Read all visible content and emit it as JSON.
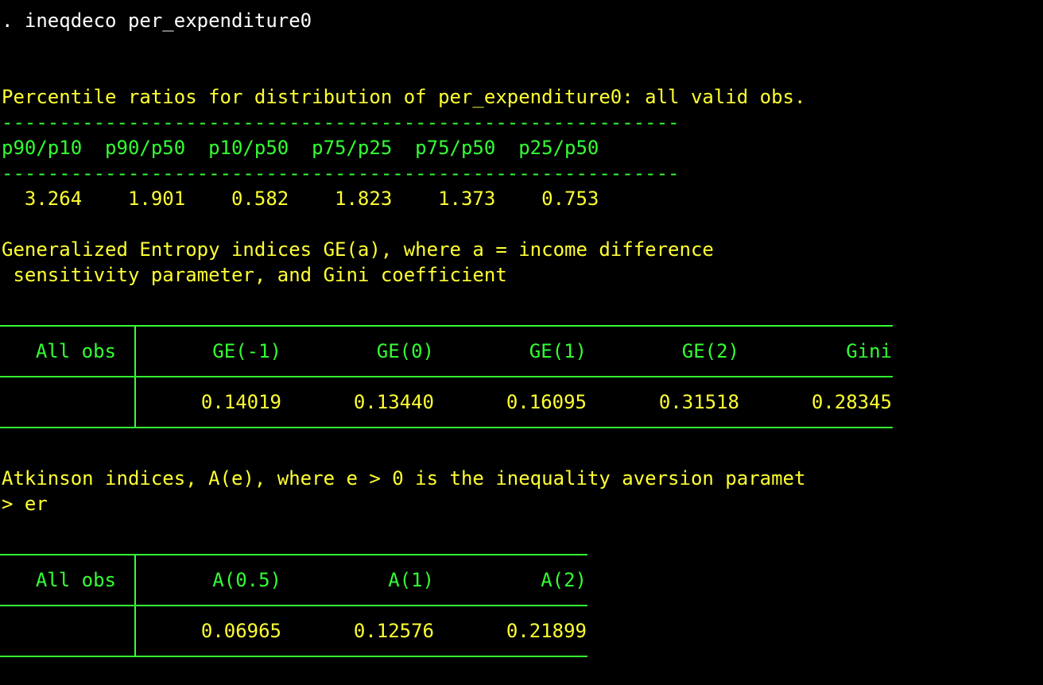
{
  "command": ". ineqdeco per_expenditure0",
  "percentile": {
    "title": "Percentile ratios for distribution of per_expenditure0: all valid obs.",
    "dashes": "-----------------------------------------------------------",
    "header": "p90/p10  p90/p50  p10/p50  p75/p25  p75/p50  p25/p50",
    "values": "  3.264    1.901    0.582    1.823    1.373    0.753"
  },
  "ge": {
    "title_line1": "Generalized Entropy indices GE(a), where a = income difference",
    "title_line2": " sensitivity parameter, and Gini coefficient",
    "row_label": "All obs",
    "headers": [
      "GE(-1)",
      "GE(0)",
      "GE(1)",
      "GE(2)",
      "Gini"
    ],
    "values": [
      "0.14019",
      "0.13440",
      "0.16095",
      "0.31518",
      "0.28345"
    ]
  },
  "atkinson": {
    "title_line1": "Atkinson indices, A(e), where e > 0 is the inequality aversion paramet",
    "title_line2": "> er",
    "row_label": "All obs",
    "headers": [
      "A(0.5)",
      "A(1)",
      "A(2)"
    ],
    "values": [
      "0.06965",
      "0.12576",
      "0.21899"
    ]
  },
  "colors": {
    "background": "#000000",
    "command": "#ffffff",
    "output": "#ffff33",
    "table": "#33ff33"
  }
}
